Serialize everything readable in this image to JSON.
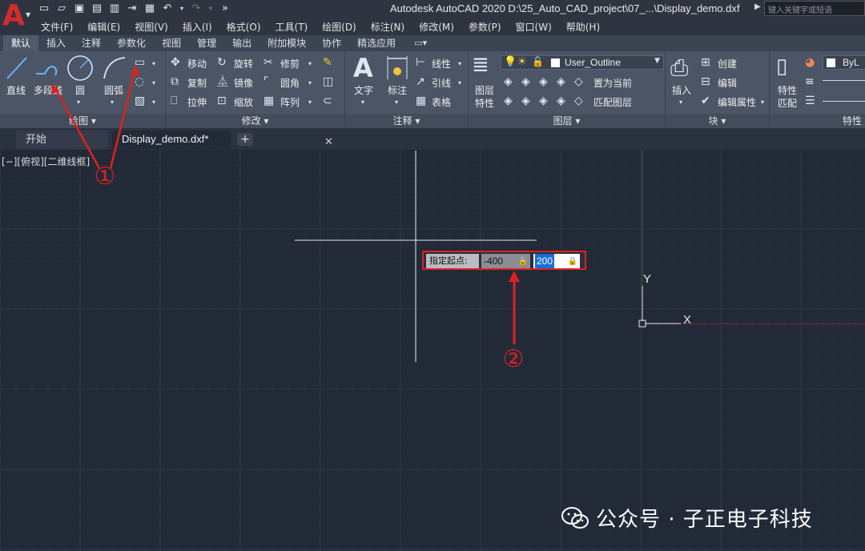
{
  "app": {
    "logo_letter": "A",
    "title": "Autodesk AutoCAD 2020   D:\\25_Auto_CAD_project\\07_...\\Display_demo.dxf",
    "search_placeholder": "键入关键字或短语"
  },
  "menu": [
    "文件(F)",
    "编辑(E)",
    "视图(V)",
    "插入(I)",
    "格式(O)",
    "工具(T)",
    "绘图(D)",
    "标注(N)",
    "修改(M)",
    "参数(P)",
    "窗口(W)",
    "帮助(H)"
  ],
  "ribbon_tabs": [
    "默认",
    "插入",
    "注释",
    "参数化",
    "视图",
    "管理",
    "输出",
    "附加模块",
    "协作",
    "精选应用"
  ],
  "ribbon": {
    "draw": {
      "title": "绘图",
      "line": "直线",
      "polyline": "多段线",
      "circle": "圆",
      "arc": "圆弧"
    },
    "modify": {
      "title": "修改",
      "move": "移动",
      "rotate": "旋转",
      "trim": "修剪",
      "copy": "复制",
      "mirror": "镜像",
      "fillet": "圆角",
      "stretch": "拉伸",
      "scale": "缩放",
      "array": "阵列"
    },
    "annotation": {
      "title": "注释",
      "text": "文字",
      "dimension": "标注",
      "linear": "线性",
      "leader": "引线",
      "table": "表格"
    },
    "layers": {
      "title": "图层",
      "properties_line1": "图层",
      "properties_line2": "特性",
      "current_layer": "User_Outline",
      "set_current": "置为当前",
      "match_layer": "匹配图层"
    },
    "block": {
      "title": "块",
      "insert": "插入",
      "create": "创建",
      "edit": "编辑",
      "edit_attributes": "编辑属性"
    },
    "properties": {
      "title": "特性",
      "match_line1": "特性",
      "match_line2": "匹配",
      "bylayer": "ByL"
    }
  },
  "doc_tabs": {
    "start": "开始",
    "drawing": "Display_demo.dxf*"
  },
  "viewport_label": "[−][俯视][二维线框]",
  "dynamic_input": {
    "prompt": "指定起点:",
    "x_value": "-400",
    "y_value": "200"
  },
  "ucs": {
    "x_label": "X",
    "y_label": "Y"
  },
  "annotations": {
    "marker1": "①",
    "marker2": "②",
    "color": "#e02020"
  },
  "watermark": "公众号 · 子正电子科技"
}
